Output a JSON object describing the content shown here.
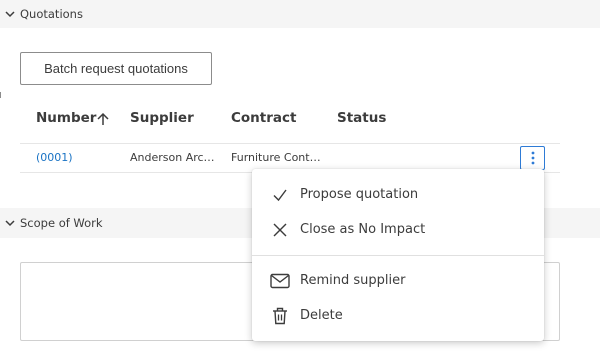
{
  "sections": {
    "quotations_title": "Quotations",
    "scope_title": "Scope of Work"
  },
  "toolbar": {
    "batch_label": "Batch request quotations"
  },
  "table": {
    "headers": {
      "number": "Number",
      "supplier": "Supplier",
      "contract": "Contract",
      "status": "Status"
    },
    "rows": [
      {
        "number": "(0001)",
        "supplier": "Anderson Arc…",
        "contract": "Furniture Cont…",
        "status": ""
      }
    ]
  },
  "menu": {
    "items": [
      {
        "label": "Propose quotation",
        "icon": "check-icon"
      },
      {
        "label": "Close as No Impact",
        "icon": "close-icon"
      },
      {
        "label": "Remind supplier",
        "icon": "mail-icon"
      },
      {
        "label": "Delete",
        "icon": "trash-icon"
      }
    ]
  },
  "colors": {
    "link": "#1a73c4",
    "accent": "#2e7bd6",
    "header_bg": "#f5f5f5"
  }
}
